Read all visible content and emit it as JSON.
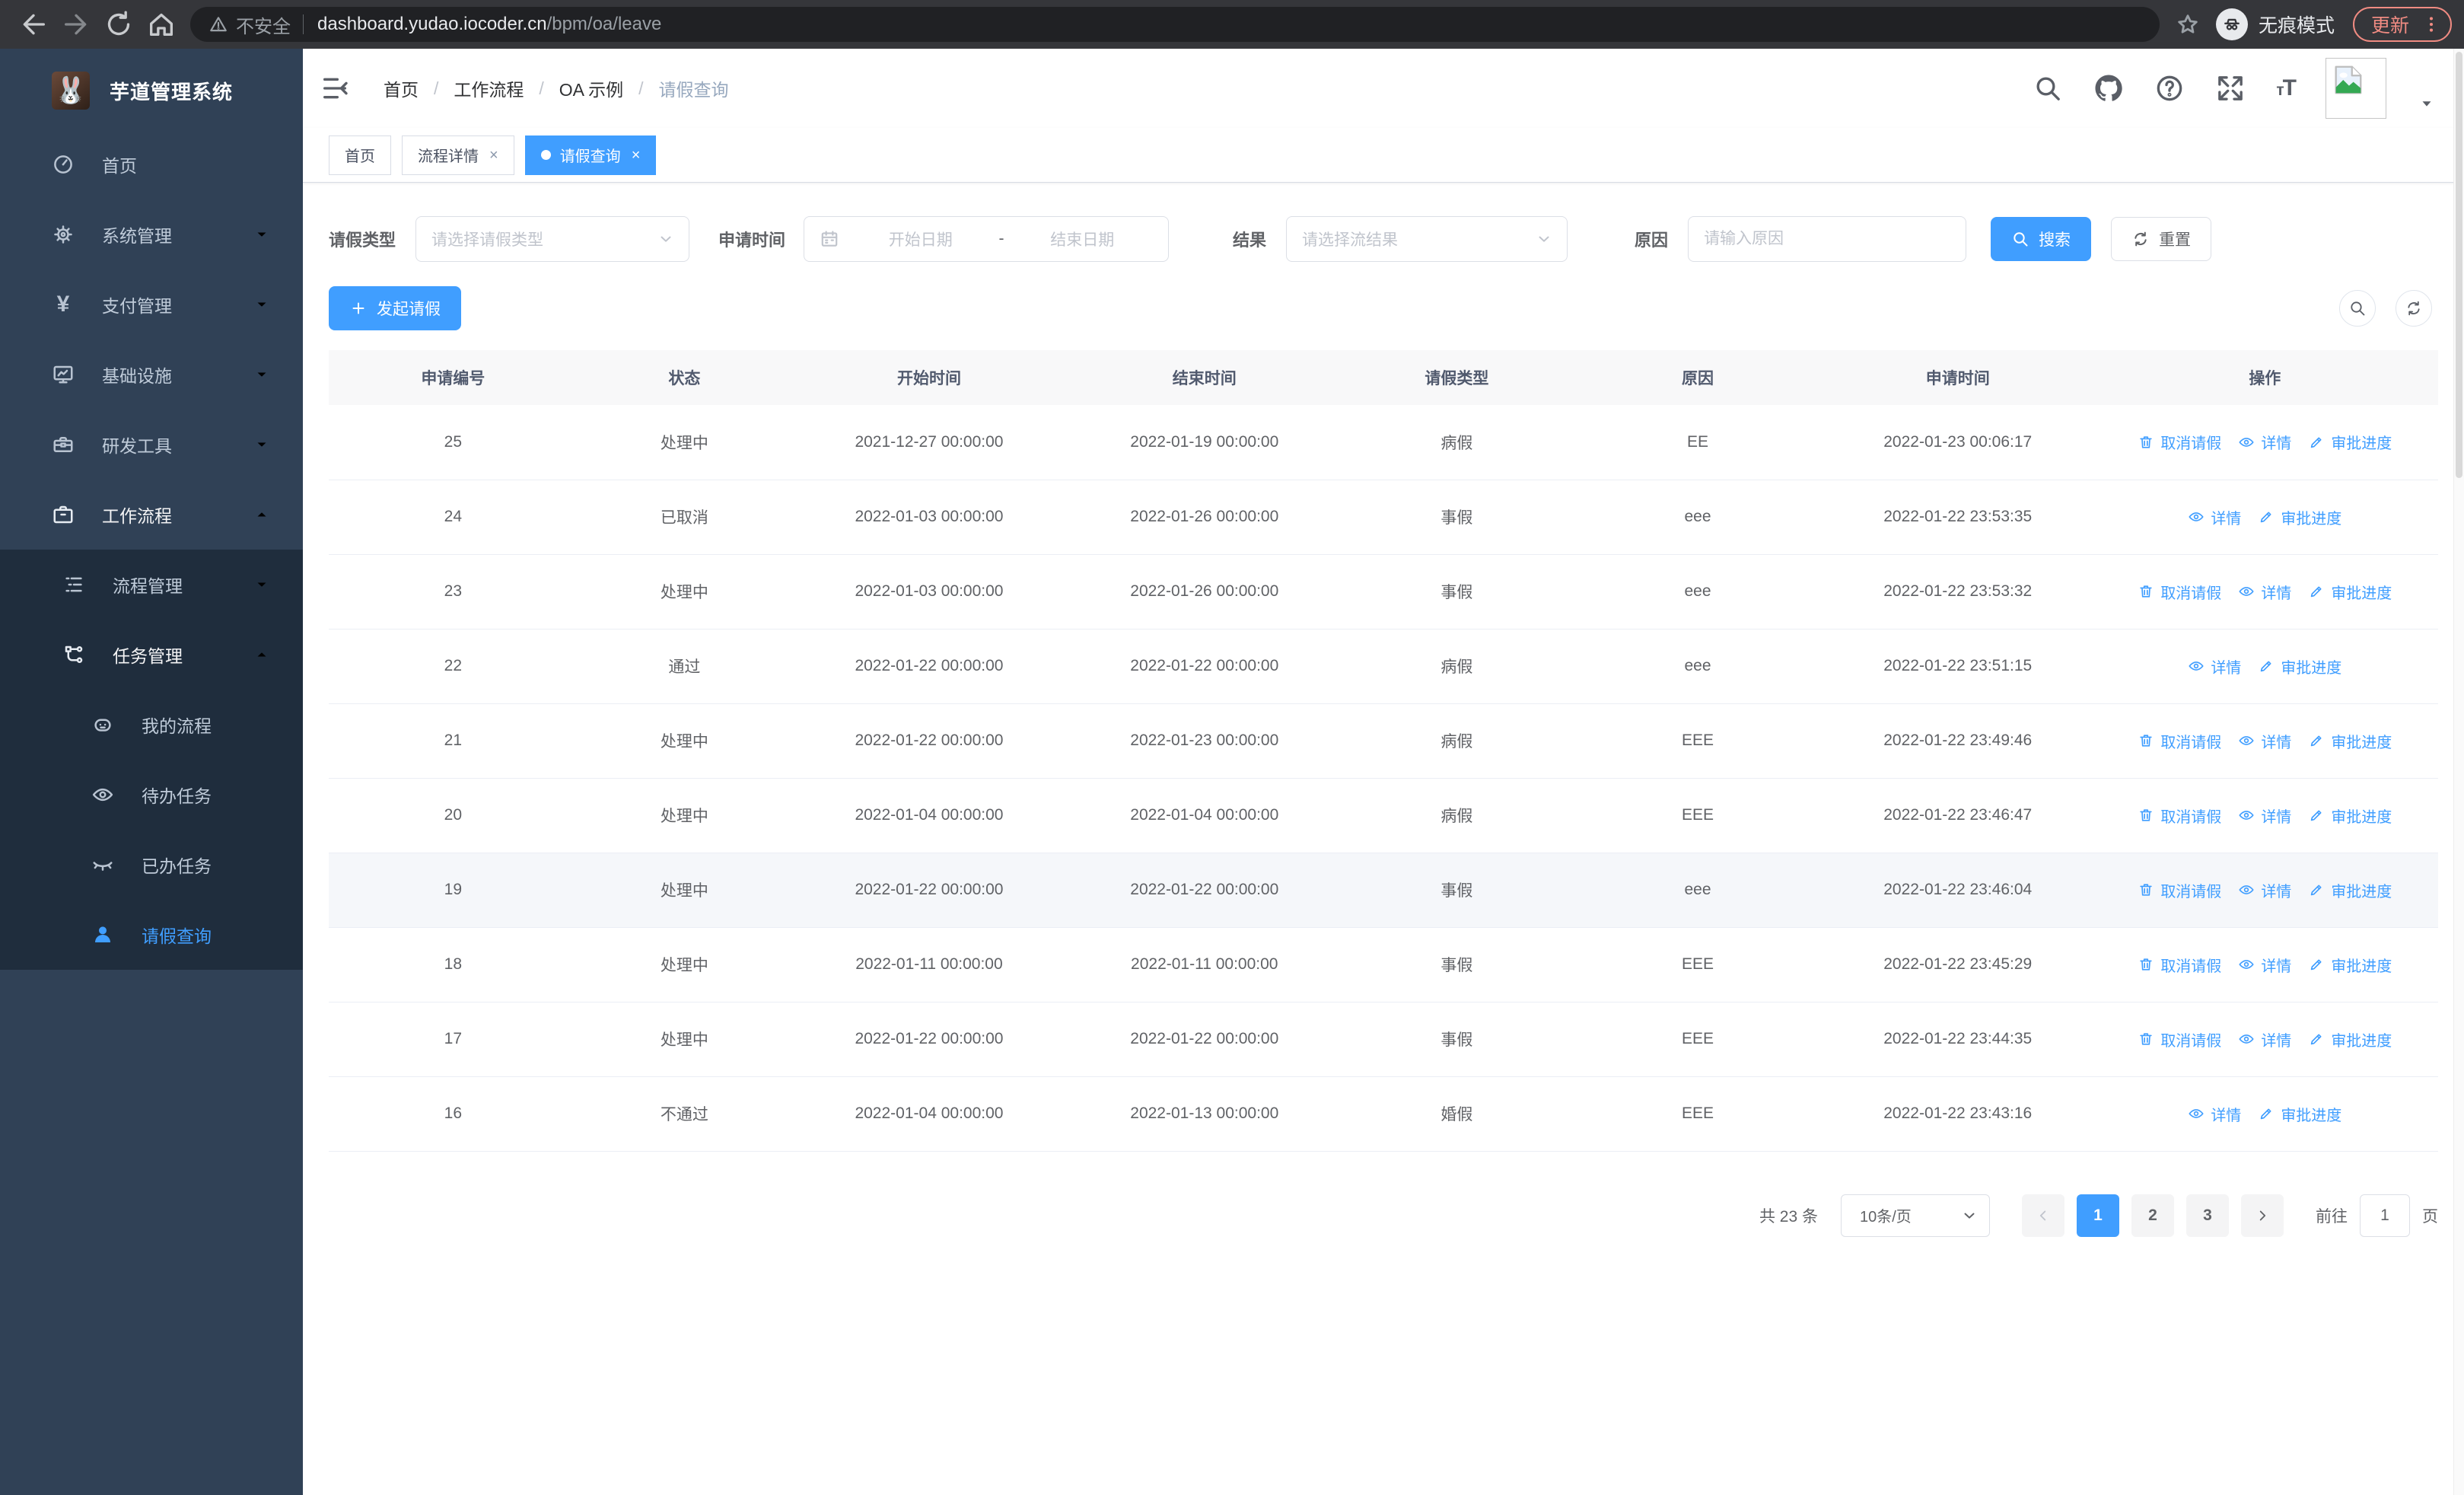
{
  "browser": {
    "security_text": "不安全",
    "url_host": "dashboard.yudao.iocoder.cn",
    "url_path": "/bpm/oa/leave",
    "incognito_text": "无痕模式",
    "update_text": "更新"
  },
  "sidebar": {
    "title": "芋道管理系统",
    "menu": [
      {
        "id": "home",
        "label": "首页",
        "icon": "dashboard-icon",
        "level": 1
      },
      {
        "id": "system",
        "label": "系统管理",
        "icon": "gear-icon",
        "level": 1,
        "chevron": "down"
      },
      {
        "id": "payment",
        "label": "支付管理",
        "icon": "yen-icon",
        "level": 1,
        "chevron": "down"
      },
      {
        "id": "infra",
        "label": "基础设施",
        "icon": "monitor-icon",
        "level": 1,
        "chevron": "down"
      },
      {
        "id": "devtools",
        "label": "研发工具",
        "icon": "toolbox-icon",
        "level": 1,
        "chevron": "down"
      },
      {
        "id": "workflow",
        "label": "工作流程",
        "icon": "briefcase-icon",
        "level": 1,
        "chevron": "up",
        "open": true
      },
      {
        "id": "process-mgmt",
        "label": "流程管理",
        "icon": "tree-list-icon",
        "level": 2,
        "chevron": "down",
        "group": "sub"
      },
      {
        "id": "task-mgmt",
        "label": "任务管理",
        "icon": "flow-icon",
        "level": 2,
        "chevron": "up",
        "open": true,
        "group": "sub"
      },
      {
        "id": "my-process",
        "label": "我的流程",
        "icon": "robot-icon",
        "level": 3,
        "group": "sub"
      },
      {
        "id": "todo-task",
        "label": "待办任务",
        "icon": "eye-icon",
        "level": 3,
        "group": "sub"
      },
      {
        "id": "done-task",
        "label": "已办任务",
        "icon": "eye-closed-icon",
        "level": 3,
        "group": "sub"
      },
      {
        "id": "leave-query",
        "label": "请假查询",
        "icon": "user-icon",
        "level": 3,
        "group": "sub",
        "active": true
      }
    ]
  },
  "header": {
    "breadcrumb": [
      "首页",
      "工作流程",
      "OA 示例",
      "请假查询"
    ]
  },
  "tabs": [
    {
      "label": "首页",
      "closable": false,
      "active": false
    },
    {
      "label": "流程详情",
      "closable": true,
      "active": false
    },
    {
      "label": "请假查询",
      "closable": true,
      "active": true
    }
  ],
  "filters": {
    "leave_type_label": "请假类型",
    "leave_type_placeholder": "请选择请假类型",
    "apply_time_label": "申请时间",
    "start_placeholder": "开始日期",
    "range_separator": "-",
    "end_placeholder": "结束日期",
    "result_label": "结果",
    "result_placeholder": "请选择流结果",
    "reason_label": "原因",
    "reason_placeholder": "请输入原因",
    "search_label": "搜索",
    "reset_label": "重置"
  },
  "toolbar": {
    "create_label": "发起请假"
  },
  "table": {
    "columns": [
      "申请编号",
      "状态",
      "开始时间",
      "结束时间",
      "请假类型",
      "原因",
      "申请时间",
      "操作"
    ],
    "action_labels": {
      "cancel": "取消请假",
      "detail": "详情",
      "progress": "审批进度"
    },
    "rows": [
      {
        "id": "25",
        "status": "处理中",
        "start": "2021-12-27 00:00:00",
        "end": "2022-01-19 00:00:00",
        "type": "病假",
        "reason": "EE",
        "applied": "2022-01-23 00:06:17",
        "actions": [
          "cancel",
          "detail",
          "progress"
        ],
        "hover": false
      },
      {
        "id": "24",
        "status": "已取消",
        "start": "2022-01-03 00:00:00",
        "end": "2022-01-26 00:00:00",
        "type": "事假",
        "reason": "eee",
        "applied": "2022-01-22 23:53:35",
        "actions": [
          "detail",
          "progress"
        ],
        "hover": false
      },
      {
        "id": "23",
        "status": "处理中",
        "start": "2022-01-03 00:00:00",
        "end": "2022-01-26 00:00:00",
        "type": "事假",
        "reason": "eee",
        "applied": "2022-01-22 23:53:32",
        "actions": [
          "cancel",
          "detail",
          "progress"
        ],
        "hover": false
      },
      {
        "id": "22",
        "status": "通过",
        "start": "2022-01-22 00:00:00",
        "end": "2022-01-22 00:00:00",
        "type": "病假",
        "reason": "eee",
        "applied": "2022-01-22 23:51:15",
        "actions": [
          "detail",
          "progress"
        ],
        "hover": false
      },
      {
        "id": "21",
        "status": "处理中",
        "start": "2022-01-22 00:00:00",
        "end": "2022-01-23 00:00:00",
        "type": "病假",
        "reason": "EEE",
        "applied": "2022-01-22 23:49:46",
        "actions": [
          "cancel",
          "detail",
          "progress"
        ],
        "hover": false
      },
      {
        "id": "20",
        "status": "处理中",
        "start": "2022-01-04 00:00:00",
        "end": "2022-01-04 00:00:00",
        "type": "病假",
        "reason": "EEE",
        "applied": "2022-01-22 23:46:47",
        "actions": [
          "cancel",
          "detail",
          "progress"
        ],
        "hover": false
      },
      {
        "id": "19",
        "status": "处理中",
        "start": "2022-01-22 00:00:00",
        "end": "2022-01-22 00:00:00",
        "type": "事假",
        "reason": "eee",
        "applied": "2022-01-22 23:46:04",
        "actions": [
          "cancel",
          "detail",
          "progress"
        ],
        "hover": true
      },
      {
        "id": "18",
        "status": "处理中",
        "start": "2022-01-11 00:00:00",
        "end": "2022-01-11 00:00:00",
        "type": "事假",
        "reason": "EEE",
        "applied": "2022-01-22 23:45:29",
        "actions": [
          "cancel",
          "detail",
          "progress"
        ],
        "hover": false
      },
      {
        "id": "17",
        "status": "处理中",
        "start": "2022-01-22 00:00:00",
        "end": "2022-01-22 00:00:00",
        "type": "事假",
        "reason": "EEE",
        "applied": "2022-01-22 23:44:35",
        "actions": [
          "cancel",
          "detail",
          "progress"
        ],
        "hover": false
      },
      {
        "id": "16",
        "status": "不通过",
        "start": "2022-01-04 00:00:00",
        "end": "2022-01-13 00:00:00",
        "type": "婚假",
        "reason": "EEE",
        "applied": "2022-01-22 23:43:16",
        "actions": [
          "detail",
          "progress"
        ],
        "hover": false
      }
    ]
  },
  "pagination": {
    "total_text": "共 23 条",
    "page_size_text": "10条/页",
    "pages": [
      "1",
      "2",
      "3"
    ],
    "active_page": "1",
    "goto_label": "前往",
    "goto_value": "1",
    "goto_suffix": "页"
  },
  "colors": {
    "primary": "#409eff",
    "sidebar_bg": "#304156",
    "sidebar_submenu_bg": "#1f2d3d",
    "update_accent": "#f08b82",
    "table_header_bg": "#f8f8f9",
    "row_hover_bg": "#f5f7fa"
  }
}
